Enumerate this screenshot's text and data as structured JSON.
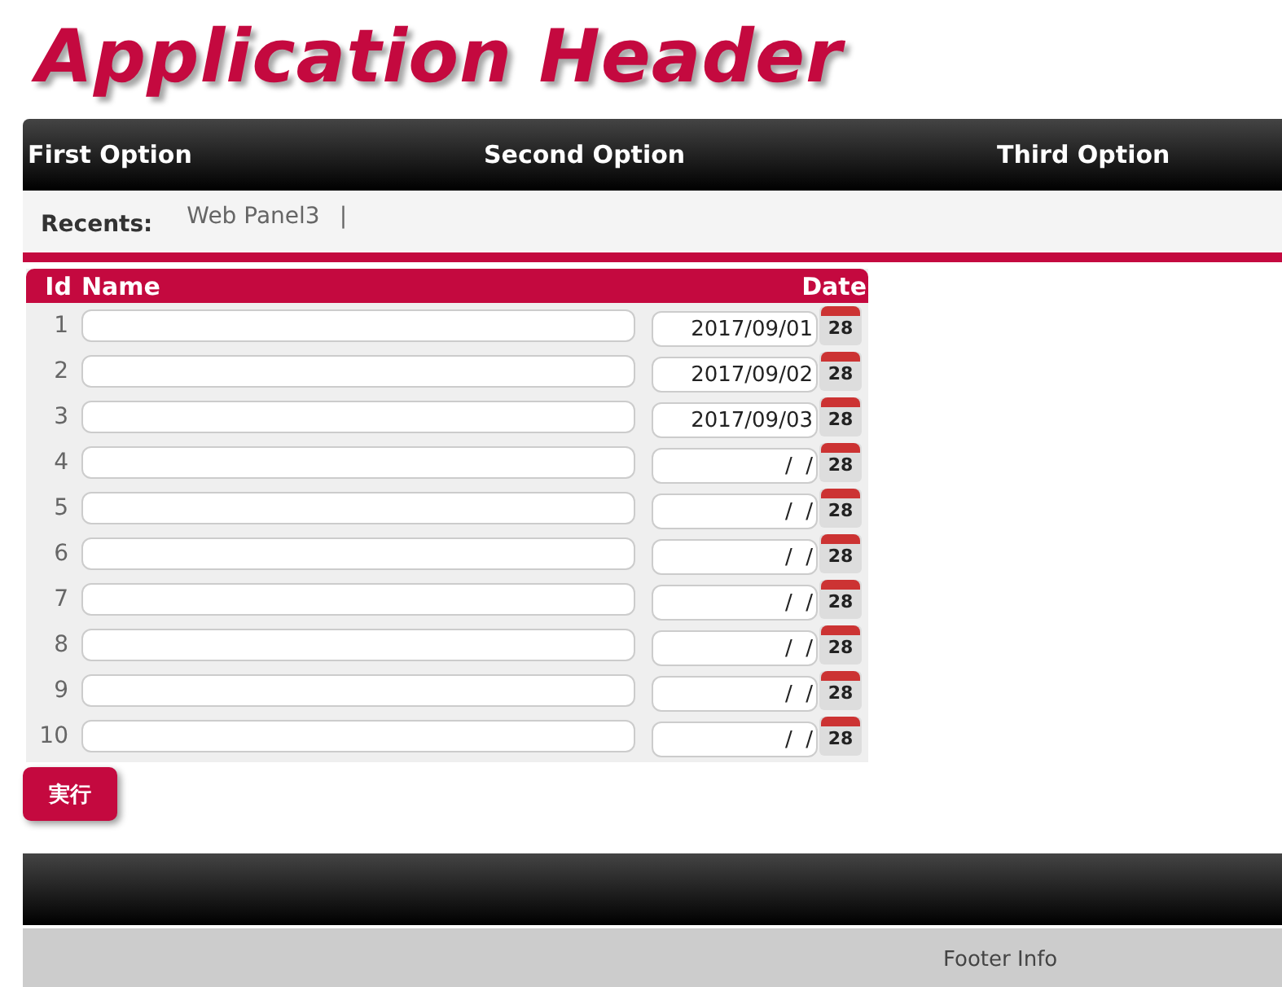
{
  "header": {
    "title": "Application Header"
  },
  "nav": [
    {
      "label": "First Option"
    },
    {
      "label": "Second Option"
    },
    {
      "label": "Third Option"
    }
  ],
  "recents": {
    "label": "Recents:",
    "items": [
      {
        "label": "Web Panel3",
        "separator": "|"
      }
    ]
  },
  "table": {
    "columns": [
      "Id",
      "Name",
      "Date"
    ],
    "rows": [
      {
        "id": "1",
        "name": "",
        "date": "2017/09/01",
        "calendar_day": "28"
      },
      {
        "id": "2",
        "name": "",
        "date": "2017/09/02",
        "calendar_day": "28"
      },
      {
        "id": "3",
        "name": "",
        "date": "2017/09/03",
        "calendar_day": "28"
      },
      {
        "id": "4",
        "name": "",
        "date": "/  /",
        "calendar_day": "28"
      },
      {
        "id": "5",
        "name": "",
        "date": "/  /",
        "calendar_day": "28"
      },
      {
        "id": "6",
        "name": "",
        "date": "/  /",
        "calendar_day": "28"
      },
      {
        "id": "7",
        "name": "",
        "date": "/  /",
        "calendar_day": "28"
      },
      {
        "id": "8",
        "name": "",
        "date": "/  /",
        "calendar_day": "28"
      },
      {
        "id": "9",
        "name": "",
        "date": "/  /",
        "calendar_day": "28"
      },
      {
        "id": "10",
        "name": "",
        "date": "/  /",
        "calendar_day": "28"
      }
    ]
  },
  "button": {
    "label": "実行"
  },
  "footer": {
    "text": "Footer Info"
  }
}
